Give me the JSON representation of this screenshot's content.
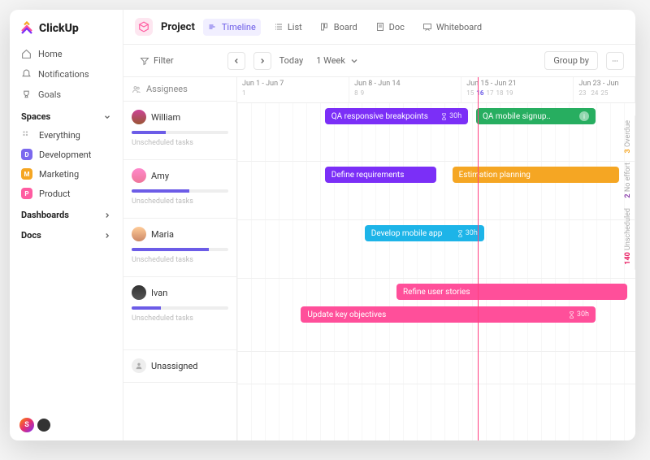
{
  "brand": "ClickUp",
  "nav": {
    "home": "Home",
    "notifications": "Notifications",
    "goals": "Goals"
  },
  "sections": {
    "spaces": "Spaces",
    "spaces_items": [
      {
        "label": "Everything"
      },
      {
        "label": "Development",
        "chip": "D",
        "color": "#7b68ee"
      },
      {
        "label": "Marketing",
        "chip": "M",
        "color": "#f5a623"
      },
      {
        "label": "Product",
        "chip": "P",
        "color": "#ff5ca1"
      }
    ],
    "dashboards": "Dashboards",
    "docs": "Docs"
  },
  "user_avatar_letter": "S",
  "project_title": "Project",
  "views": {
    "timeline": "Timeline",
    "list": "List",
    "board": "Board",
    "doc": "Doc",
    "whiteboard": "Whiteboard"
  },
  "toolbar": {
    "filter": "Filter",
    "today": "Today",
    "range": "1 Week",
    "group_by": "Group by"
  },
  "assignees_header": "Assignees",
  "weeks": [
    "Jun 1 - Jun 7",
    "Jun 8 - Jun 14",
    "Jun 15 - Jun 21",
    "Jun 23 - Jun"
  ],
  "days_wk1": [
    "1",
    "",
    "",
    "",
    "",
    "",
    ""
  ],
  "days_wk2": [
    "8",
    "9",
    "",
    "",
    "",
    "",
    ""
  ],
  "days_wk3": [
    "15",
    "16",
    "17",
    "18",
    "19",
    "",
    ""
  ],
  "days_wk4": [
    "23",
    "",
    "24",
    "25"
  ],
  "current_day_label": "16",
  "unscheduled_label": "Unscheduled tasks",
  "assignees": [
    {
      "name": "William",
      "progress": 35
    },
    {
      "name": "Amy",
      "progress": 60
    },
    {
      "name": "Maria",
      "progress": 80
    },
    {
      "name": "Ivan",
      "progress": 30
    },
    {
      "name": "Unassigned",
      "progress": null
    }
  ],
  "tasks": {
    "william": [
      {
        "label": "QA responsive breakpoints",
        "hours": "30h",
        "color": "#7b2ff7"
      },
      {
        "label": "QA mobile signup..",
        "color": "#27ae60",
        "info": true
      }
    ],
    "amy": [
      {
        "label": "Define requirements",
        "color": "#7b2ff7"
      },
      {
        "label": "Estimation planning",
        "color": "#f5a623"
      }
    ],
    "maria": [
      {
        "label": "Develop mobile app",
        "hours": "30h",
        "color": "#1db4e8"
      }
    ],
    "ivan": [
      {
        "label": "Refine user stories",
        "color": "#ff4f9a"
      },
      {
        "label": "Update key objectives",
        "hours": "30h",
        "color": "#ff4f9a"
      }
    ]
  },
  "side_badges": {
    "overdue_count": "3",
    "overdue_label": "Overdue",
    "noeffort_count": "2",
    "noeffort_label": "No effort",
    "unsched_count": "140",
    "unsched_label": "Unscheduled"
  },
  "colors": {
    "accent": "#6c5ce7"
  }
}
